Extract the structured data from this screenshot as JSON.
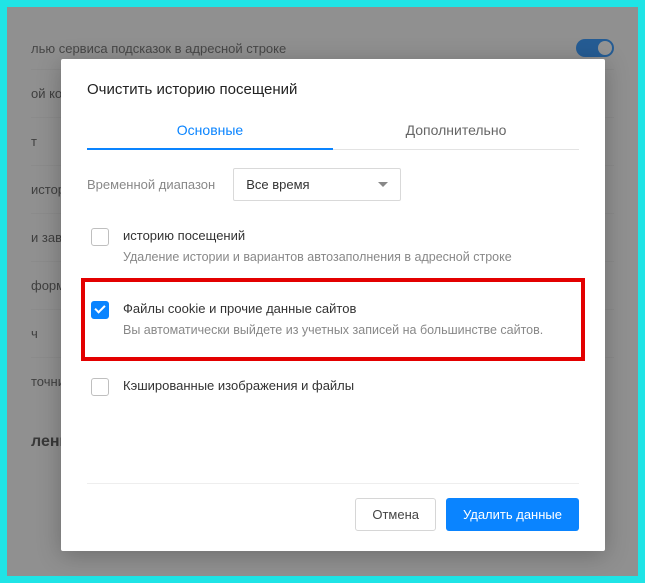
{
  "background": {
    "setting_text": "лью сервиса подсказок в адресной строке",
    "items": [
      "ой конт",
      "т",
      "истори",
      "и заверш",
      "формац",
      "ч",
      "точник"
    ],
    "heading": "ление"
  },
  "dialog": {
    "title": "Очистить историю посещений",
    "tabs": {
      "basic": "Основные",
      "advanced": "Дополнительно"
    },
    "range_label": "Временной диапазон",
    "range_value": "Все время",
    "items": {
      "history": {
        "title": "историю посещений",
        "sub": "Удаление истории и вариантов автозаполнения в адресной строке"
      },
      "cookies": {
        "title": "Файлы cookie и прочие данные сайтов",
        "sub": "Вы автоматически выйдете из учетных записей на большинстве сайтов."
      },
      "cache": {
        "title": "Кэшированные изображения и файлы"
      }
    },
    "actions": {
      "cancel": "Отмена",
      "confirm": "Удалить данные"
    }
  }
}
